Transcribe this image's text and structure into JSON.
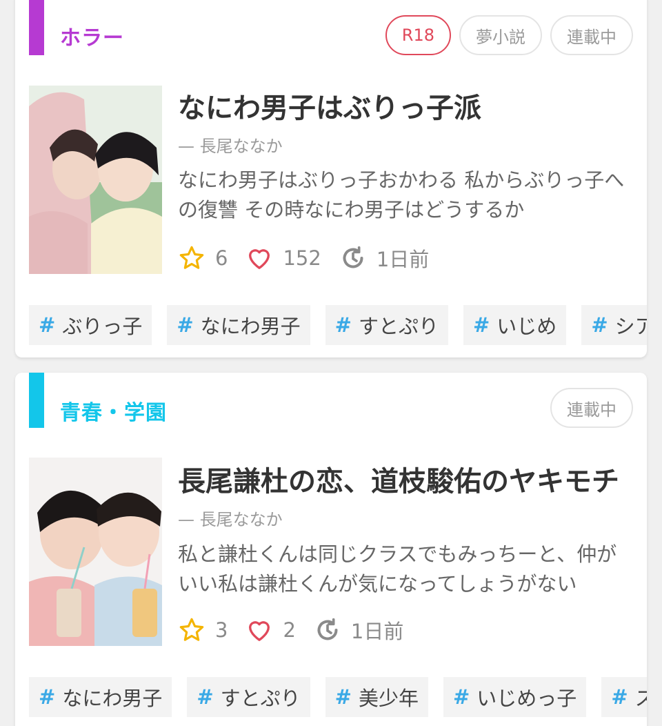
{
  "colors": {
    "horror": "#b63ad2",
    "youth": "#13c6ea",
    "r18": "#e0485a",
    "star": "#f4b400",
    "heart": "#e0485a",
    "tag_hash": "#3aa9e6"
  },
  "icons": {
    "star": "star-icon",
    "heart": "heart-icon",
    "updated": "history-clock-icon",
    "tag": "hashtag-icon"
  },
  "stories": [
    {
      "genre": "ホラー",
      "badges": [
        "R18",
        "夢小説",
        "連載中"
      ],
      "title": "なにわ男子はぶりっ子派",
      "author": "— 長尾ななか",
      "description": "なにわ男子はぶりっ子おかわる 私からぶりっ子への復讐 その時なにわ男子はどうするか",
      "stars": "6",
      "likes": "152",
      "updated": "1日前",
      "tags": [
        "ぶりっ子",
        "なにわ男子",
        "すとぷり",
        "いじめ",
        "シア"
      ]
    },
    {
      "genre": "青春・学園",
      "badges": [
        "連載中"
      ],
      "title": "長尾謙杜の恋、道枝駿佑のヤキモチ",
      "author": "— 長尾ななか",
      "description": "私と謙杜くんは同じクラスでもみっちーと、仲がいい私は謙杜くんが気になってしょうがない",
      "stars": "3",
      "likes": "2",
      "updated": "1日前",
      "tags": [
        "なにわ男子",
        "すとぷり",
        "美少年",
        "いじめっ子",
        "ス"
      ]
    }
  ],
  "hash_symbol": "#"
}
